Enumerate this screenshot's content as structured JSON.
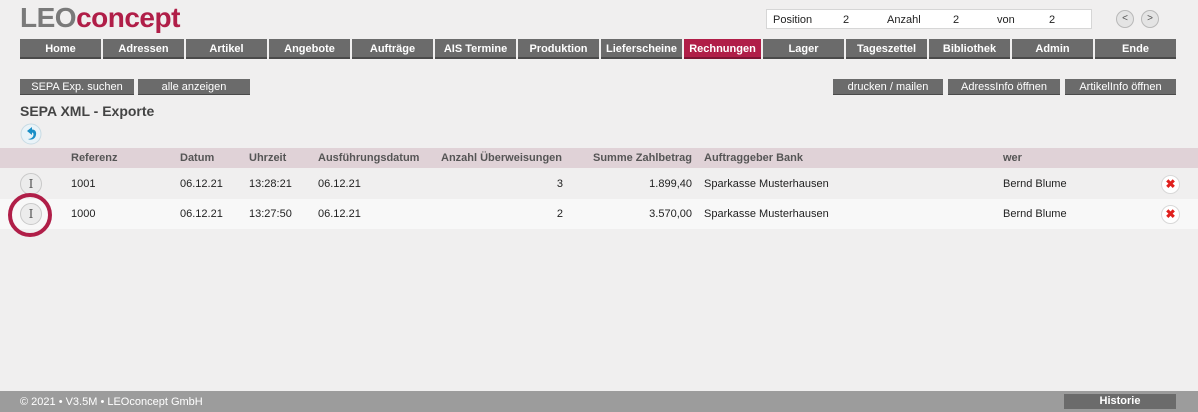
{
  "logo": {
    "part1": "LEO",
    "part2": "concept"
  },
  "position_box": {
    "position_label": "Position",
    "position_value": "2",
    "anzahl_label": "Anzahl",
    "anzahl_value": "2",
    "von_label": "von",
    "von_value": "2"
  },
  "pager": {
    "prev": "<",
    "next": ">"
  },
  "menu": [
    {
      "label": "Home"
    },
    {
      "label": "Adressen"
    },
    {
      "label": "Artikel"
    },
    {
      "label": "Angebote"
    },
    {
      "label": "Aufträge"
    },
    {
      "label": "AIS Termine"
    },
    {
      "label": "Produktion"
    },
    {
      "label": "Lieferscheine"
    },
    {
      "label": "Rechnungen",
      "active": true
    },
    {
      "label": "Lager"
    },
    {
      "label": "Tageszettel"
    },
    {
      "label": "Bibliothek"
    },
    {
      "label": "Admin"
    },
    {
      "label": "Ende"
    }
  ],
  "toolbar": {
    "sepa_search": "SEPA Exp. suchen",
    "show_all": "alle anzeigen",
    "print_mail": "drucken / mailen",
    "address_info": "AdressInfo öffnen",
    "article_info": "ArtikelInfo öffnen"
  },
  "page_title": "SEPA XML - Exporte",
  "table": {
    "headers": {
      "referenz": "Referenz",
      "datum": "Datum",
      "uhrzeit": "Uhrzeit",
      "ausfuehrung": "Ausführungsdatum",
      "anzahl": "Anzahl Überweisungen",
      "summe": "Summe Zahlbetrag",
      "bank": "Auftraggeber Bank",
      "wer": "wer"
    },
    "rows": [
      {
        "referenz": "1001",
        "datum": "06.12.21",
        "uhrzeit": "13:28:21",
        "ausfuehrung": "06.12.21",
        "anzahl": "3",
        "summe": "1.899,40",
        "bank": "Sparkasse Musterhausen",
        "wer": "Bernd Blume"
      },
      {
        "referenz": "1000",
        "datum": "06.12.21",
        "uhrzeit": "13:27:50",
        "ausfuehrung": "06.12.21",
        "anzahl": "2",
        "summe": "3.570,00",
        "bank": "Sparkasse Musterhausen",
        "wer": "Bernd Blume"
      }
    ],
    "info_icon": "I",
    "delete_icon": "✖"
  },
  "footer": {
    "copyright": "© 2021 • V3.5M • LEOconcept GmbH",
    "history": "Historie"
  },
  "colors": {
    "accent": "#b01e48",
    "button": "#6b6b6b",
    "header_row": "#e0d2d7"
  }
}
